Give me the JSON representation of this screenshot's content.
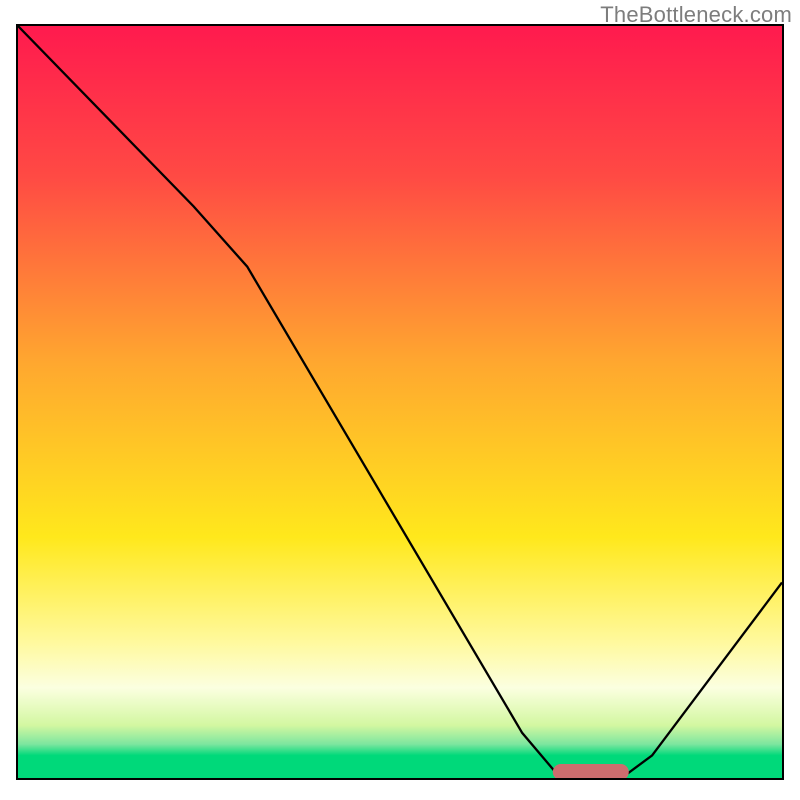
{
  "watermark": "TheBottleneck.com",
  "colors": {
    "frame": "#000000",
    "marker": "#cc6d6e",
    "gradient_top": "#ff1a4e",
    "gradient_bottom": "#00d97a"
  },
  "chart_data": {
    "type": "line",
    "title": "",
    "xlabel": "",
    "ylabel": "",
    "xlim": [
      0,
      100
    ],
    "ylim": [
      0,
      100
    ],
    "grid": false,
    "legend": false,
    "series": [
      {
        "name": "bottleneck-curve",
        "x": [
          0,
          23,
          30,
          66,
          71,
          79,
          83,
          100
        ],
        "values": [
          100,
          76,
          68,
          6,
          0,
          0,
          3,
          26
        ]
      }
    ],
    "annotations": [
      {
        "name": "optimal-marker",
        "x_center": 75,
        "y": 0,
        "width_x": 10,
        "shape": "pill"
      }
    ],
    "background": {
      "type": "vertical-gradient",
      "stops": [
        {
          "pos": 0.0,
          "color": "#ff1a4e"
        },
        {
          "pos": 0.2,
          "color": "#ff4a44"
        },
        {
          "pos": 0.45,
          "color": "#ffa82f"
        },
        {
          "pos": 0.68,
          "color": "#ffe81c"
        },
        {
          "pos": 0.82,
          "color": "#fff99e"
        },
        {
          "pos": 0.88,
          "color": "#fbffe0"
        },
        {
          "pos": 0.93,
          "color": "#d3f7a1"
        },
        {
          "pos": 0.955,
          "color": "#7de69f"
        },
        {
          "pos": 0.97,
          "color": "#00d97a"
        },
        {
          "pos": 1.0,
          "color": "#00d97a"
        }
      ]
    }
  }
}
